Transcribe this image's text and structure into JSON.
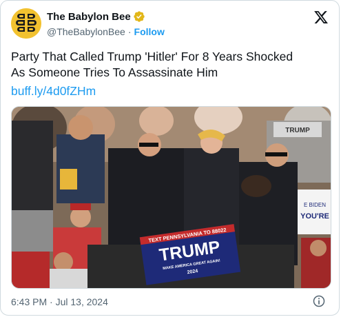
{
  "account": {
    "display_name": "The Babylon Bee",
    "handle": "@TheBabylonBee",
    "separator": "·",
    "follow_label": "Follow"
  },
  "tweet": {
    "text": "Party That Called Trump 'Hitler' For 8 Years Shocked\nAs Someone Tries To Assassinate Him",
    "link": "buff.ly/4d0fZHm"
  },
  "media": {
    "sign_top": "TEXT PENNSYLVANIA TO 88022",
    "sign_main": "TRUMP",
    "sign_bottom": "MAKE AMERICA GREAT AGAIN!",
    "sign_year": "2024",
    "bg_sign_right": "TRUMP",
    "bg_sign_right_sub": "YOU'RE",
    "bg_sign_right_sub2": "E BIDEN"
  },
  "footer": {
    "timestamp": "6:43 PM · Jul 13, 2024"
  },
  "colors": {
    "link": "#1d9bf0",
    "muted": "#536471",
    "verified_gold": "#e2b719",
    "sign_blue": "#1e2a78"
  }
}
